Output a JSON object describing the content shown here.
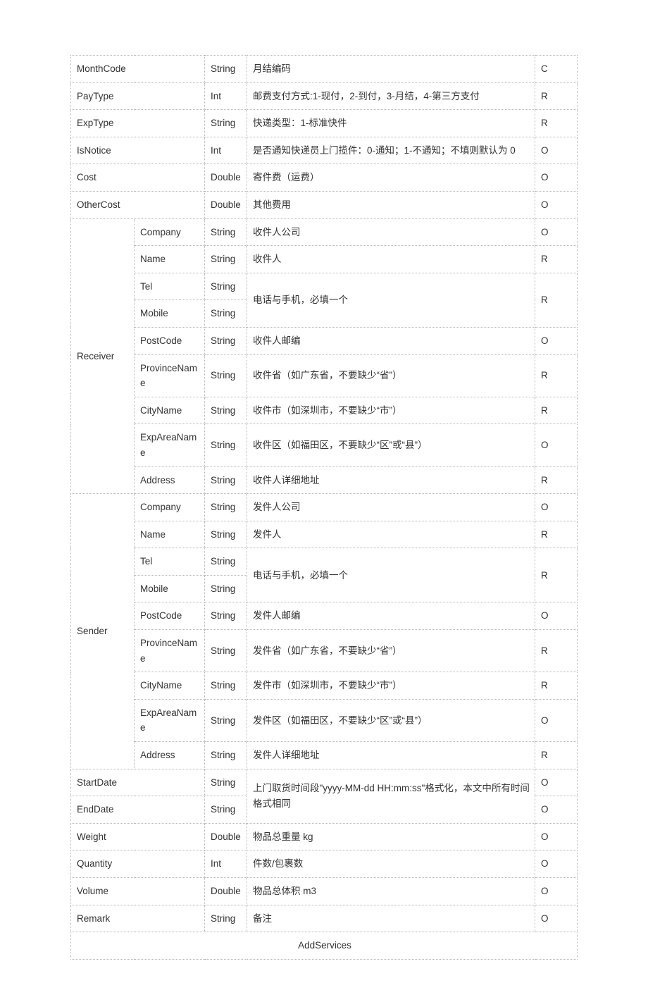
{
  "rows": {
    "monthcode": {
      "name": "MonthCode",
      "type": "String",
      "desc": "月结编码",
      "req": "C"
    },
    "paytype": {
      "name": "PayType",
      "type": "Int",
      "desc": "邮费支付方式:1-现付，2-到付，3-月结，4-第三方支付",
      "req": "R"
    },
    "exptype": {
      "name": "ExpType",
      "type": "String",
      "desc": "快递类型：1-标准快件",
      "req": "R"
    },
    "isnotice": {
      "name": "IsNotice",
      "type": "Int",
      "desc": "是否通知快递员上门揽件：0-通知；1-不通知；不填则默认为 0",
      "req": "O"
    },
    "cost": {
      "name": "Cost",
      "type": "Double",
      "desc": "寄件费（运费）",
      "req": "O"
    },
    "othercost": {
      "name": "OtherCost",
      "type": "Double",
      "desc": "其他费用",
      "req": "O"
    },
    "receiver": {
      "name": "Receiver",
      "company": {
        "name": "Company",
        "type": "String",
        "desc": "收件人公司",
        "req": "O"
      },
      "personname": {
        "name": "Name",
        "type": "String",
        "desc": "收件人",
        "req": "R"
      },
      "tel": {
        "name": "Tel",
        "type": "String"
      },
      "mobile": {
        "name": "Mobile",
        "type": "String"
      },
      "telmobile_desc": "电话与手机，必填一个",
      "telmobile_req": "R",
      "postcode": {
        "name": "PostCode",
        "type": "String",
        "desc": "收件人邮编",
        "req": "O"
      },
      "province": {
        "name": "ProvinceName",
        "type": "String",
        "desc": "收件省（如广东省，不要缺少“省”）",
        "req": "R"
      },
      "city": {
        "name": "CityName",
        "type": "String",
        "desc": "收件市（如深圳市，不要缺少“市”）",
        "req": "R"
      },
      "exparea": {
        "name": "ExpAreaName",
        "type": "String",
        "desc": "收件区（如福田区，不要缺少“区”或“县”）",
        "req": "O"
      },
      "address": {
        "name": "Address",
        "type": "String",
        "desc": "收件人详细地址",
        "req": "R"
      }
    },
    "sender": {
      "name": "Sender",
      "company": {
        "name": "Company",
        "type": "String",
        "desc": "发件人公司",
        "req": "O"
      },
      "personname": {
        "name": "Name",
        "type": "String",
        "desc": "发件人",
        "req": "R"
      },
      "tel": {
        "name": "Tel",
        "type": "String"
      },
      "mobile": {
        "name": "Mobile",
        "type": "String"
      },
      "telmobile_desc": "电话与手机，必填一个",
      "telmobile_req": "R",
      "postcode": {
        "name": "PostCode",
        "type": "String",
        "desc": "发件人邮编",
        "req": "O"
      },
      "province": {
        "name": "ProvinceName",
        "type": "String",
        "desc": "发件省（如广东省，不要缺少“省”）",
        "req": "R"
      },
      "city": {
        "name": "CityName",
        "type": "String",
        "desc": "发件市（如深圳市，不要缺少“市”）",
        "req": "R"
      },
      "exparea": {
        "name": "ExpAreaName",
        "type": "String",
        "desc": "发件区（如福田区，不要缺少“区”或“县”）",
        "req": "O"
      },
      "address": {
        "name": "Address",
        "type": "String",
        "desc": "发件人详细地址",
        "req": "R"
      }
    },
    "startdate": {
      "name": "StartDate",
      "type": "String",
      "req": "O"
    },
    "enddate": {
      "name": "EndDate",
      "type": "String",
      "req": "O"
    },
    "startend_desc": "上门取货时间段\"yyyy-MM-dd HH:mm:ss\"格式化，本文中所有时间格式相同",
    "weight": {
      "name": "Weight",
      "type": "Double",
      "desc": "物品总重量 kg",
      "req": "O"
    },
    "quantity": {
      "name": "Quantity",
      "type": "Int",
      "desc": "件数/包裹数",
      "req": "O"
    },
    "volume": {
      "name": "Volume",
      "type": "Double",
      "desc": "物品总体积 m3",
      "req": "O"
    },
    "remark": {
      "name": "Remark",
      "type": "String",
      "desc": "备注",
      "req": "O"
    },
    "addservices": "AddServices"
  }
}
